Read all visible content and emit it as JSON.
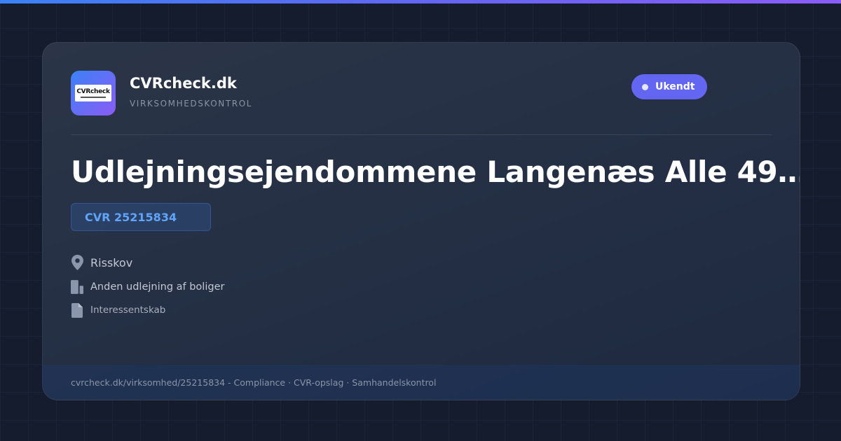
{
  "brand": {
    "name": "CVRcheck.dk",
    "tagline": "VIRKSOMHEDSKONTROL",
    "logo_text": "CVRcheck"
  },
  "status": {
    "label": "Ukendt",
    "color": "#6366f1"
  },
  "company": {
    "title": "Udlejningsejendommene Langenæs Alle 49…",
    "cvr": "CVR 25215834"
  },
  "info": [
    {
      "icon": "location-pin-icon",
      "text": "Risskov"
    },
    {
      "icon": "building-icon",
      "text": "Anden udlejning af boliger"
    },
    {
      "icon": "document-icon",
      "text": "Interessentskab"
    }
  ],
  "footer": {
    "text": "cvrcheck.dk/virksomhed/25215834 - Compliance · CVR-opslag · Samhandelskontrol"
  },
  "colors": {
    "background": "#141c2e",
    "accent": "#6366f1",
    "cvr_text": "#60a5fa"
  }
}
